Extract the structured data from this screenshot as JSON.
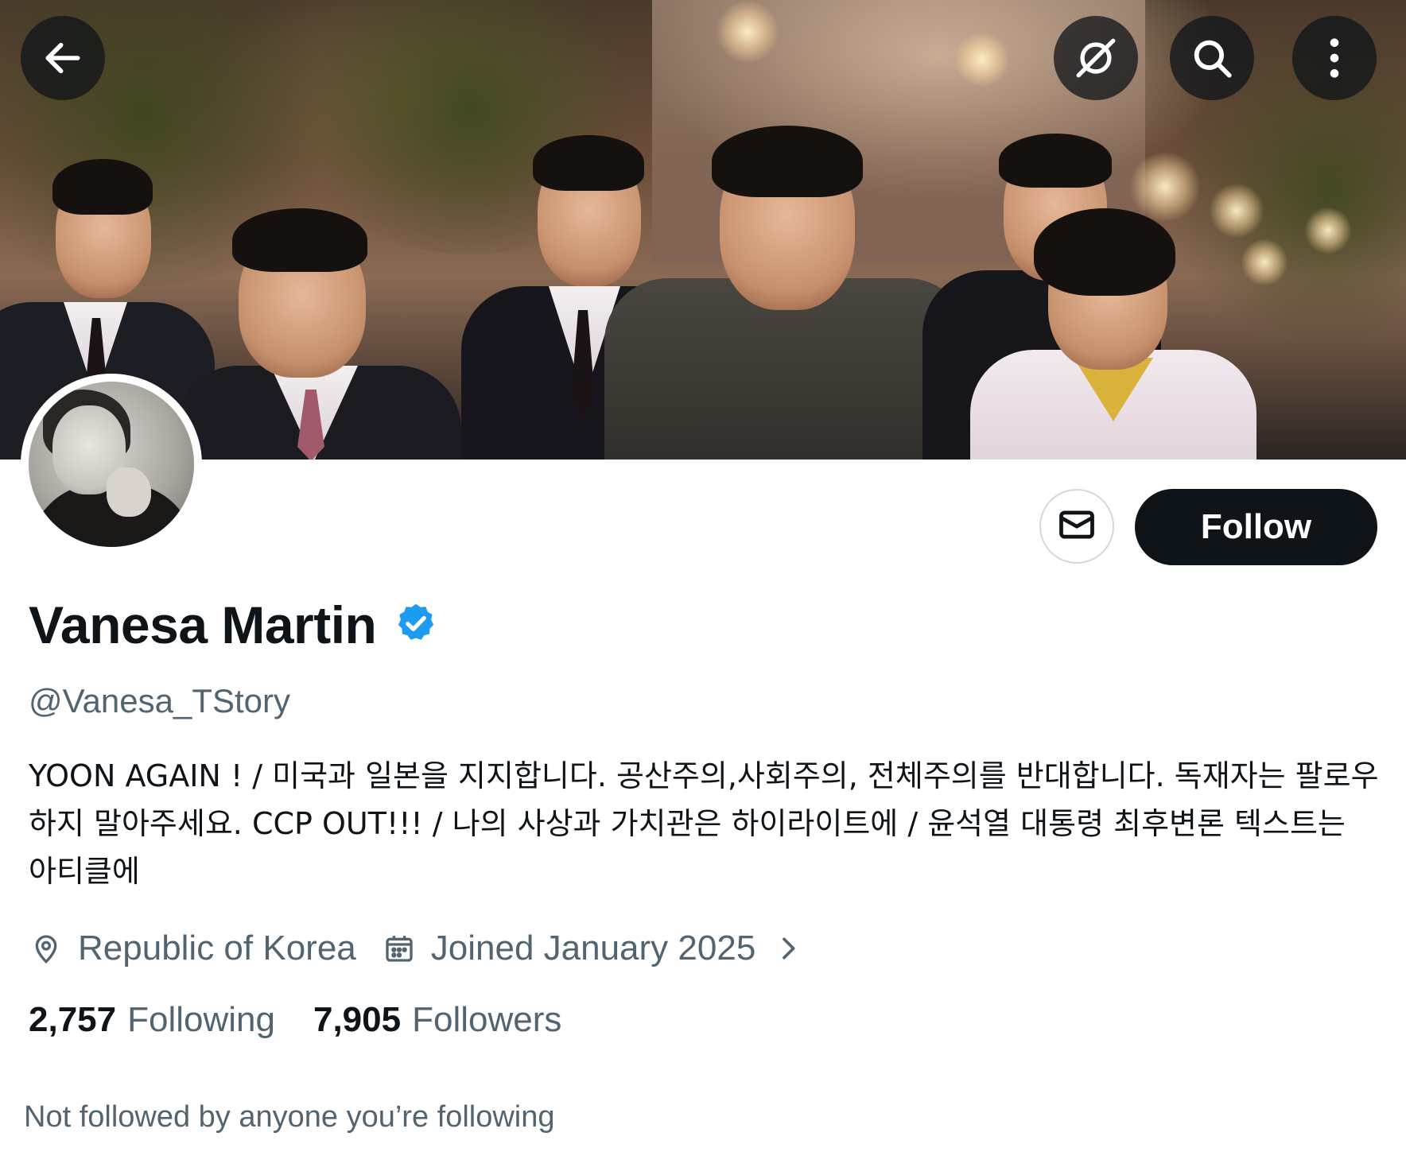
{
  "header": {
    "back_icon": "arrow-left-icon",
    "grok_icon": "grok-icon",
    "search_icon": "search-icon",
    "more_icon": "more-vertical-icon"
  },
  "profile": {
    "display_name": "Vanesa Martin",
    "verified": true,
    "handle": "@Vanesa_TStory",
    "bio": "YOON AGAIN ! / 미국과 일본을 지지합니다. 공산주의,사회주의, 전체주의를 반대합니다. 독재자는 팔로우 하지 말아주세요. CCP OUT!!! / 나의 사상과 가치관은 하이라이트에 / 윤석열 대통령 최후변론 텍스트는 아티클에",
    "location": "Republic of Korea",
    "joined": "Joined January 2025",
    "following_count": "2,757",
    "following_label": "Following",
    "followers_count": "7,905",
    "followers_label": "Followers",
    "mutuals_note": "Not followed by anyone you’re following"
  },
  "actions": {
    "message_icon": "envelope-icon",
    "follow_label": "Follow"
  },
  "colors": {
    "primary_text": "#0f1419",
    "secondary_text": "#536471",
    "verified_blue": "#1d9bf0",
    "button_dark": "#0f1419",
    "border": "#cfd9de"
  }
}
